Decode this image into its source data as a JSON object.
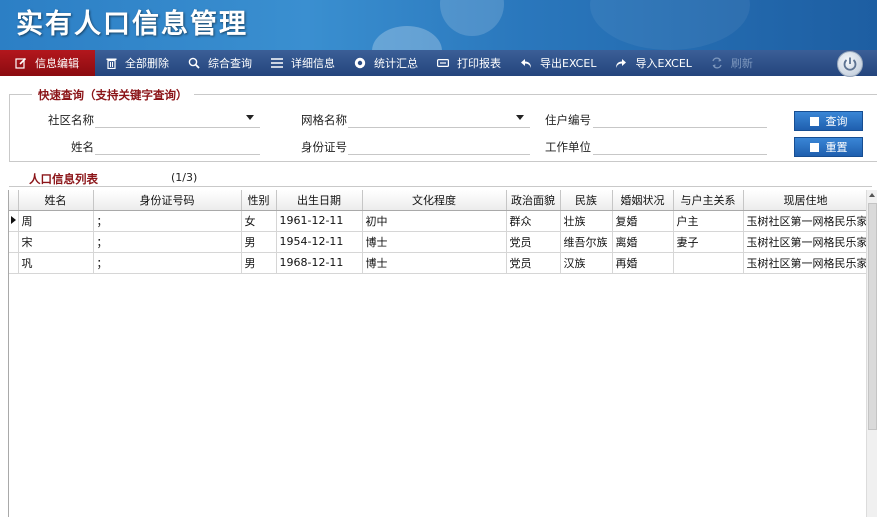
{
  "app": {
    "title": "实有人口信息管理"
  },
  "toolbar": [
    {
      "label": "信息编辑",
      "icon": "edit-icon"
    },
    {
      "label": "全部删除",
      "icon": "trash-icon"
    },
    {
      "label": "综合查询",
      "icon": "search-icon"
    },
    {
      "label": "详细信息",
      "icon": "list-icon"
    },
    {
      "label": "统计汇总",
      "icon": "stats-icon"
    },
    {
      "label": "打印报表",
      "icon": "print-icon"
    },
    {
      "label": "导出EXCEL",
      "icon": "export-icon"
    },
    {
      "label": "导入EXCEL",
      "icon": "import-icon"
    },
    {
      "label": "刷新",
      "icon": "refresh-icon"
    }
  ],
  "query": {
    "legend": "快速查询（支持关键字查询）",
    "community_label": "社区名称",
    "grid_label": "网格名称",
    "household_label": "住户编号",
    "name_label": "姓名",
    "id_label": "身份证号",
    "work_label": "工作单位",
    "search_button": "查询",
    "reset_button": "重置"
  },
  "list": {
    "title": "人口信息列表",
    "count": "(1/3)",
    "columns": [
      "姓名",
      "身份证号码",
      "性别",
      "出生日期",
      "文化程度",
      "政治面貌",
      "民族",
      "婚姻状况",
      "与户主关系",
      "现居住地"
    ],
    "rows": [
      [
        "周",
        "；",
        "女",
        "1961-12-11",
        "初中",
        "群众",
        "壮族",
        "复婚",
        "户主",
        "玉树社区第一网格民乐家"
      ],
      [
        "宋",
        "；",
        "男",
        "1954-12-11",
        "博士",
        "党员",
        "维吾尔族",
        "离婚",
        "妻子",
        "玉树社区第一网格民乐家"
      ],
      [
        "巩",
        "；",
        "男",
        "1968-12-11",
        "博士",
        "党员",
        "汉族",
        "再婚",
        "",
        "玉树社区第一网格民乐家"
      ]
    ]
  },
  "colors": {
    "banner": "#2a77bc",
    "toolbar": "#24457d",
    "active": "#a3141a",
    "accent_text": "#8b1418",
    "button": "#1f5fae"
  }
}
